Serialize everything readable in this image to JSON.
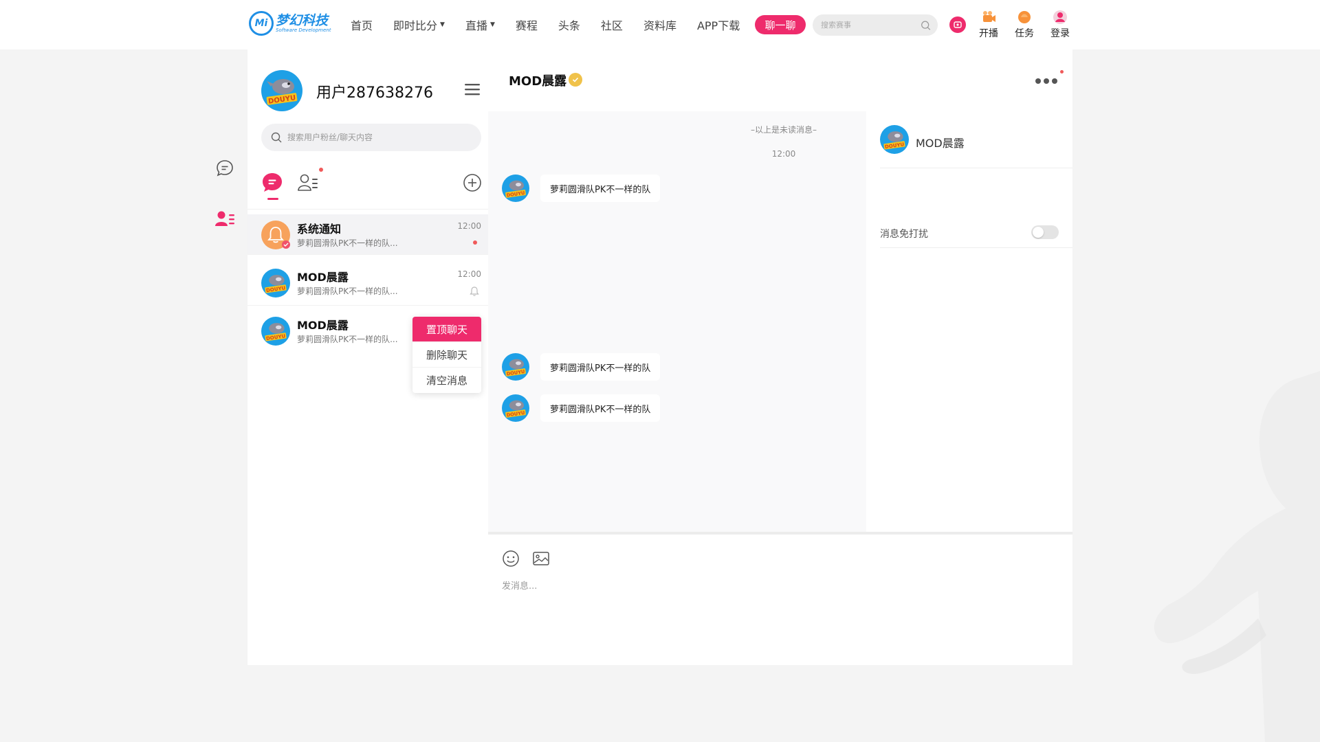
{
  "brand": {
    "name_cn": "梦幻科技",
    "name_en": "Software Development",
    "mark": "Mi",
    "color": "#1f8fe5"
  },
  "accent_color": "#ee2b6c",
  "nav": {
    "items": [
      {
        "label": "首页"
      },
      {
        "label": "即时比分",
        "dropdown": true
      },
      {
        "label": "直播",
        "dropdown": true
      },
      {
        "label": "赛程"
      },
      {
        "label": "头条"
      },
      {
        "label": "社区"
      },
      {
        "label": "资料库"
      },
      {
        "label": "APP下载"
      }
    ],
    "chat_button": "聊一聊",
    "search_placeholder": "搜索赛事",
    "actions": [
      {
        "label": "开播",
        "icon": "broadcast-icon"
      },
      {
        "label": "任务",
        "icon": "task-icon"
      },
      {
        "label": "登录",
        "icon": "user-login-icon"
      }
    ]
  },
  "sidebar": {
    "icons": [
      {
        "icon": "chat-bubble-icon",
        "active": false
      },
      {
        "icon": "contacts-icon",
        "active": true
      }
    ]
  },
  "profile": {
    "username": "用户287638276",
    "avatar": "douyu-avatar",
    "search_placeholder": "搜索用户粉丝/聊天内容"
  },
  "conversations": [
    {
      "name": "系统通知",
      "preview": "萝莉圆滑队PK不一样的队...",
      "time": "12:00",
      "unread": true,
      "avatar": "system-notice-bell-avatar"
    },
    {
      "name": "MOD晨露",
      "preview": "萝莉圆滑队PK不一样的队...",
      "time": "12:00",
      "muted": true,
      "avatar": "douyu-avatar"
    },
    {
      "name": "MOD晨露",
      "preview": "萝莉圆滑队PK不一样的队...",
      "time": "",
      "avatar": "douyu-avatar"
    }
  ],
  "context_menu": {
    "items": [
      "置顶聊天",
      "删除聊天",
      "清空消息"
    ],
    "highlighted_index": 0
  },
  "chat": {
    "title": "MOD晨露",
    "verified": true,
    "unread_divider": "–以上是未读消息–",
    "time_label": "12:00",
    "messages": [
      {
        "text": "萝莉圆滑队PK不一样的队"
      },
      {
        "text": "萝莉圆滑队PK不一样的队"
      },
      {
        "text": "萝莉圆滑队PK不一样的队"
      }
    ],
    "input_placeholder": "发消息..."
  },
  "side_panel": {
    "name": "MOD晨露",
    "dnd_label": "消息免打扰",
    "dnd_enabled": false
  }
}
